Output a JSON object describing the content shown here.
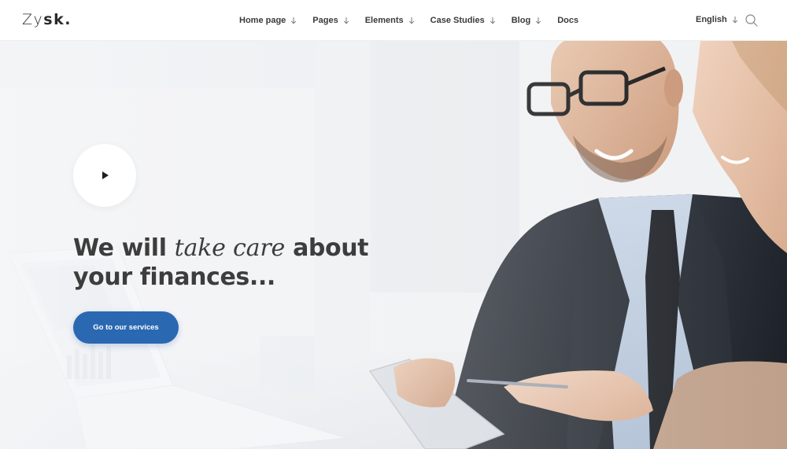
{
  "brand": {
    "logo_first": "Zy",
    "logo_second": "sk",
    "logo_dot": "."
  },
  "nav": {
    "items": [
      {
        "label": "Home page"
      },
      {
        "label": "Pages"
      },
      {
        "label": "Elements"
      },
      {
        "label": "Case Studies"
      },
      {
        "label": "Blog"
      },
      {
        "label": "Docs"
      }
    ]
  },
  "language": {
    "label": "English"
  },
  "hero": {
    "headline_part1": "We will ",
    "headline_italic": "take care",
    "headline_part2": " about",
    "headline_line2": "your finances...",
    "cta_label": "Go to our services"
  },
  "colors": {
    "accent": "#2b68b2",
    "text": "#3d3d3d",
    "header_bg": "#ffffff"
  },
  "icons": {
    "play": "play-icon",
    "search": "search-icon",
    "dropdown": "chevron-down-icon"
  }
}
